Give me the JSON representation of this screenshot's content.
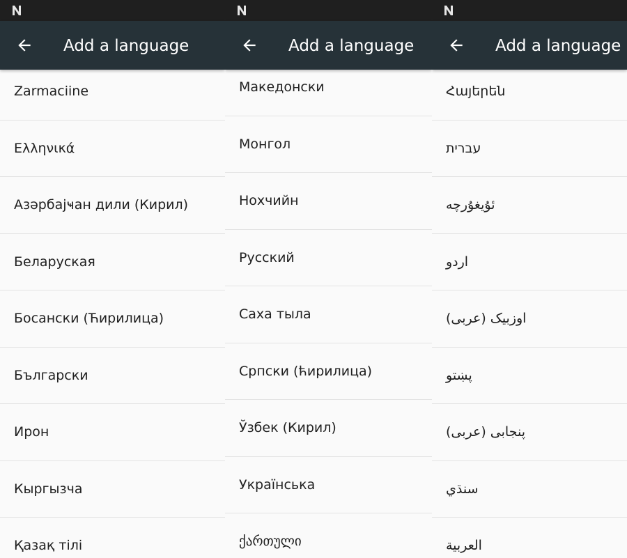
{
  "screens": [
    {
      "title": "Add a language",
      "languages": [
        "Zarmaciine",
        "Ελληνικά",
        "Азәрбајҹан дили (Кирил)",
        "Беларуская",
        "Босански (Ћирилица)",
        "Български",
        "Ирон",
        "Кыргызча",
        "Қазақ тілі"
      ]
    },
    {
      "title": "Add a language",
      "languages": [
        "Македонски",
        "Монгол",
        "Нохчийн",
        "Русский",
        "Саха тыла",
        "Српски (ћирилица)",
        "Ўзбек (Кирил)",
        "Українська",
        "ქართული"
      ]
    },
    {
      "title": "Add a language",
      "languages": [
        "Հայերեն",
        "עברית",
        "ئۇيغۇرچە",
        "اردو",
        "اوزبیک (عربی)",
        "پښتو",
        "پنجابی (عربی)",
        "سنڌي",
        "العربية"
      ]
    }
  ],
  "colors": {
    "toolbar": "#263238",
    "statusbar": "#1f1f1f",
    "background": "#fafafa",
    "divider": "#e3e3e3",
    "text": "#212121"
  },
  "icons": {
    "status": "nougat-n-icon",
    "back": "back-arrow-icon"
  }
}
